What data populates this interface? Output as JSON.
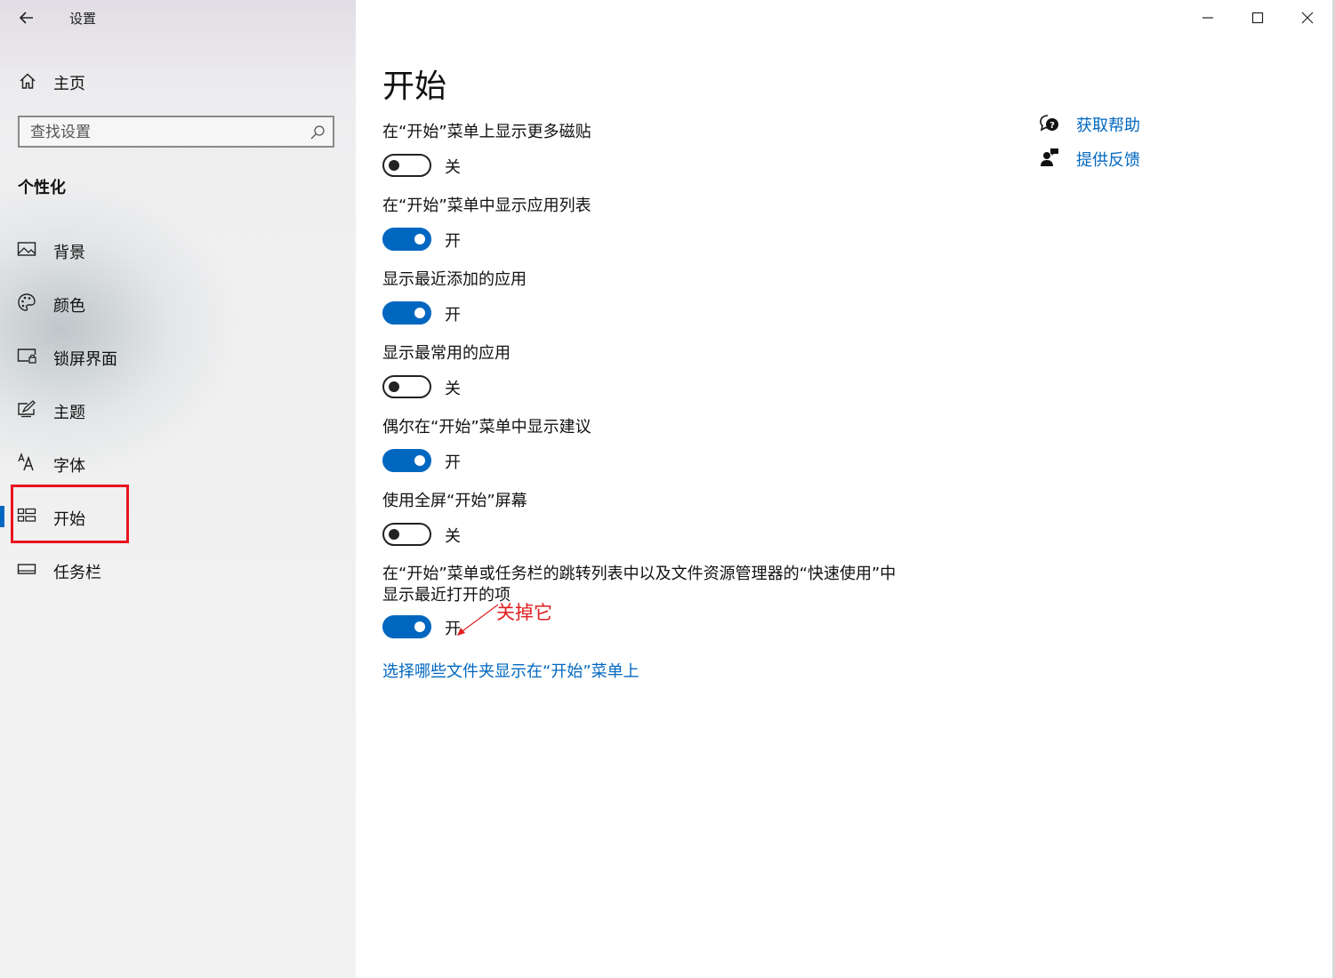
{
  "window": {
    "title": "设置"
  },
  "sidebar": {
    "home": "主页",
    "search_placeholder": "查找设置",
    "section": "个性化",
    "items": [
      {
        "label": "背景",
        "icon": "picture-icon"
      },
      {
        "label": "颜色",
        "icon": "palette-icon"
      },
      {
        "label": "锁屏界面",
        "icon": "lock-screen-icon"
      },
      {
        "label": "主题",
        "icon": "theme-icon"
      },
      {
        "label": "字体",
        "icon": "font-icon"
      },
      {
        "label": "开始",
        "icon": "start-icon",
        "selected": true
      },
      {
        "label": "任务栏",
        "icon": "taskbar-icon"
      }
    ]
  },
  "main": {
    "title": "开始",
    "settings": [
      {
        "label": "在“开始”菜单上显示更多磁贴",
        "state": "关",
        "on": false
      },
      {
        "label": "在“开始”菜单中显示应用列表",
        "state": "开",
        "on": true
      },
      {
        "label": "显示最近添加的应用",
        "state": "开",
        "on": true
      },
      {
        "label": "显示最常用的应用",
        "state": "关",
        "on": false
      },
      {
        "label": "偶尔在“开始”菜单中显示建议",
        "state": "开",
        "on": true
      },
      {
        "label": "使用全屏“开始”屏幕",
        "state": "关",
        "on": false
      },
      {
        "label_line1": "在“开始”菜单或任务栏的跳转列表中以及文件资源管理器的“快速使用”中",
        "label_line2": "显示最近打开的项",
        "state": "开",
        "on": true
      }
    ],
    "folders_link": "选择哪些文件夹显示在“开始”菜单上"
  },
  "help": {
    "get_help": "获取帮助",
    "feedback": "提供反馈"
  },
  "annotation": {
    "text": "关掉它",
    "color": "#e02020"
  },
  "colors": {
    "accent": "#0067c0",
    "highlight": "#e8141e"
  }
}
